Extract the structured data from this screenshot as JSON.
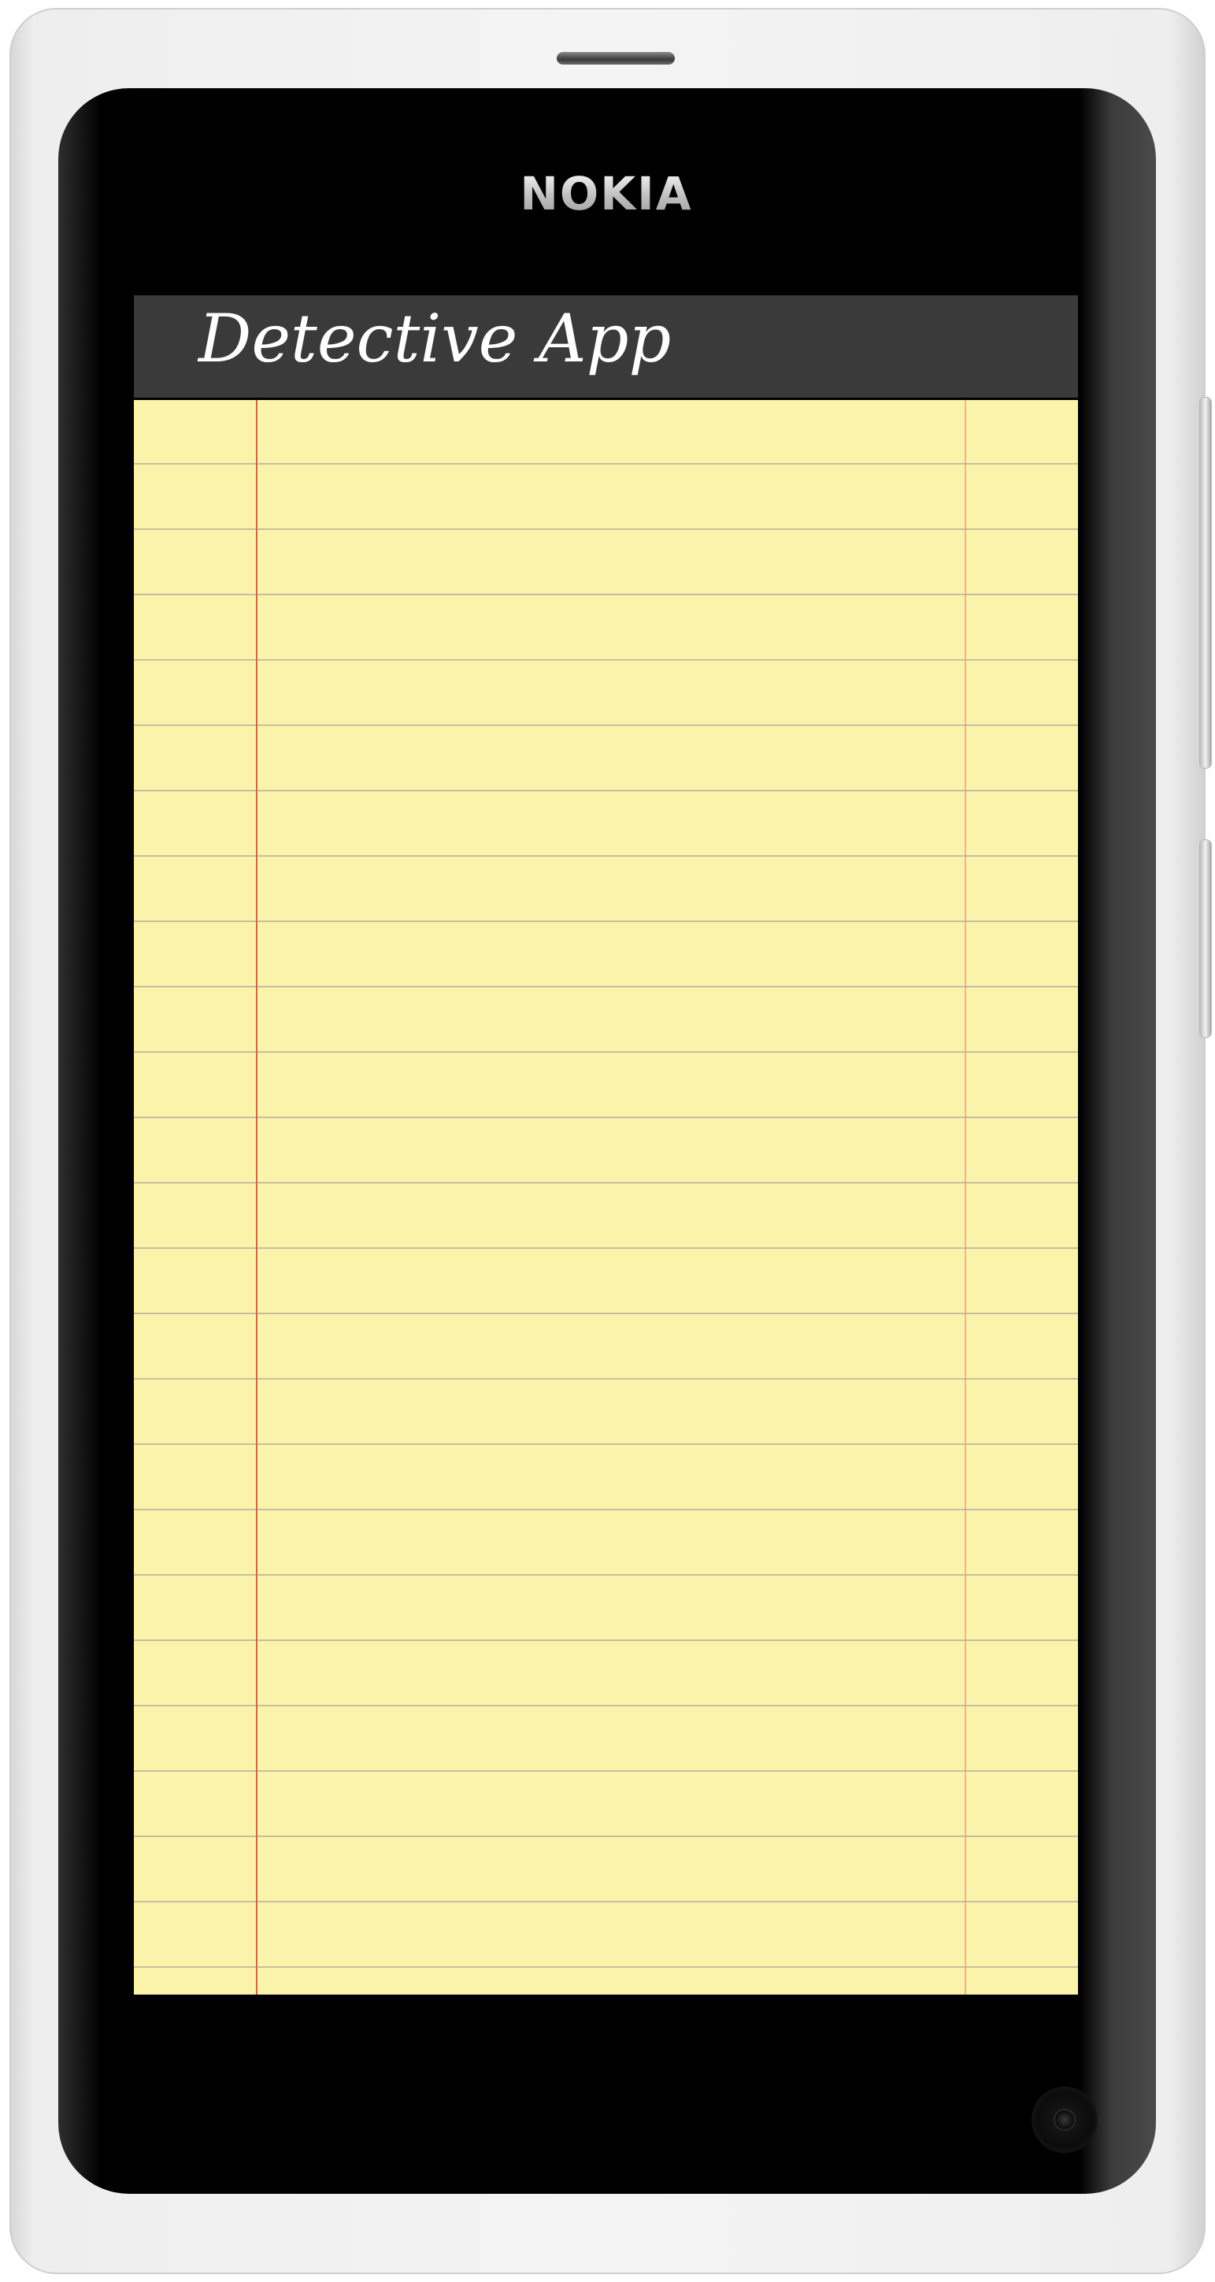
{
  "device": {
    "brand": "NOKIA",
    "shell_color": "#f0f0f0",
    "face_color": "#000000"
  },
  "app": {
    "title": "Detective App",
    "header_color": "#3a3a3a",
    "paper_color": "#fbf3a9",
    "margin_line_color": "#e65a4a"
  }
}
